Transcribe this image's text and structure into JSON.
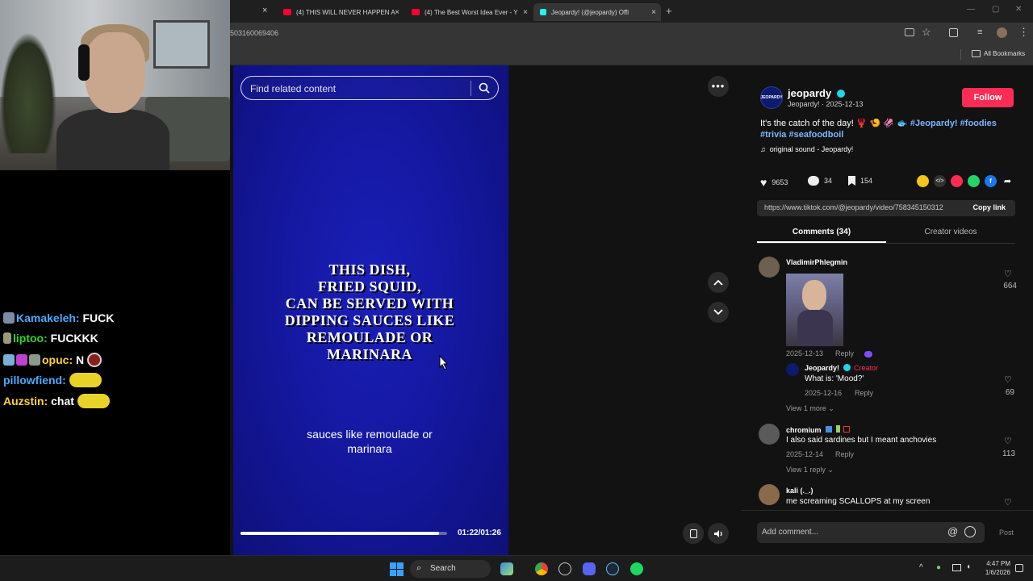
{
  "browser": {
    "tabs": [
      {
        "label": "(4) THIS WILL NEVER HAPPEN A",
        "favicon_color": "#ff0033"
      },
      {
        "label": "(4) The Best Worst Idea Ever - Y",
        "favicon_color": "#ff0033"
      },
      {
        "label": "Jeopardy! (@jeopardy) Offi",
        "favicon_color": "#25f4ee",
        "active": true
      }
    ],
    "new_tab_glyph": "+",
    "close_glyph": "×",
    "address_url": "503160069406",
    "bookmarks_label": "All Bookmarks",
    "window_controls": [
      "—",
      "▢",
      "✕"
    ]
  },
  "video": {
    "search_placeholder": "Find related content",
    "clue_lines": [
      "THIS DISH,",
      "FRIED SQUID,",
      "CAN BE SERVED WITH",
      "DIPPING SAUCES LIKE",
      "REMOULADE OR",
      "MARINARA"
    ],
    "caption_lines": [
      "sauces like remoulade or",
      "marinara"
    ],
    "progress_fraction": 0.96,
    "time": "01:22/01:26",
    "background_color": "#1518a0"
  },
  "post": {
    "username": "jeopardy",
    "avatar_text": "JEOPARDY",
    "subline": "Jeopardy! · 2025-12-13",
    "follow_label": "Follow",
    "description_text": "It's the catch of the day! 🦞 🍤 🦑 🐟",
    "hashtags": [
      "#Jeopardy!",
      "#foodies",
      "#trivia",
      "#seafoodboil"
    ],
    "sound": "original sound - Jeopardy!",
    "likes": "9653",
    "comments": "34",
    "saves": "154",
    "link": "https://www.tiktok.com/@jeopardy/video/758345150312",
    "copy_label": "Copy link",
    "tab_comments": "Comments (34)",
    "tab_creator": "Creator videos",
    "accent_color": "#fe2c55"
  },
  "comments": [
    {
      "name": "VladimirPhlegmin",
      "date": "2025-12-13",
      "reply": "Reply",
      "likes": "664"
    },
    {
      "name": "Jeopardy!",
      "creator_label": "Creator",
      "text": "What is: 'Mood?'",
      "date": "2025-12-16",
      "reply": "Reply",
      "likes": "69"
    },
    {
      "view_more": "View 1 more"
    },
    {
      "name": "chromium",
      "text": "I also said sardines but I meant anchovies",
      "date": "2025-12-14",
      "reply": "Reply",
      "likes": "113"
    },
    {
      "view_more": "View 1 reply"
    },
    {
      "name": "kali (._.)",
      "text": "me screaming SCALLOPS at my screen"
    }
  ],
  "comment_input": {
    "placeholder": "Add comment...",
    "post_label": "Post"
  },
  "chat": [
    {
      "user": "Kamakeleh:",
      "msg": "FUCK",
      "color": "#4aa8ff"
    },
    {
      "user": "liptoo:",
      "msg": "FUCKKK",
      "color": "#2fd52f"
    },
    {
      "user": "opuc:",
      "msg": "N",
      "color": "#ffd23a"
    },
    {
      "user": "pillowfiend:",
      "msg": "",
      "color": "#4aa8ff"
    },
    {
      "user": "Auzstin:",
      "msg": "chat",
      "color": "#ffd23a"
    }
  ],
  "taskbar": {
    "search_label": "Search",
    "time": "4:47 PM",
    "date": "1/6/2026"
  }
}
